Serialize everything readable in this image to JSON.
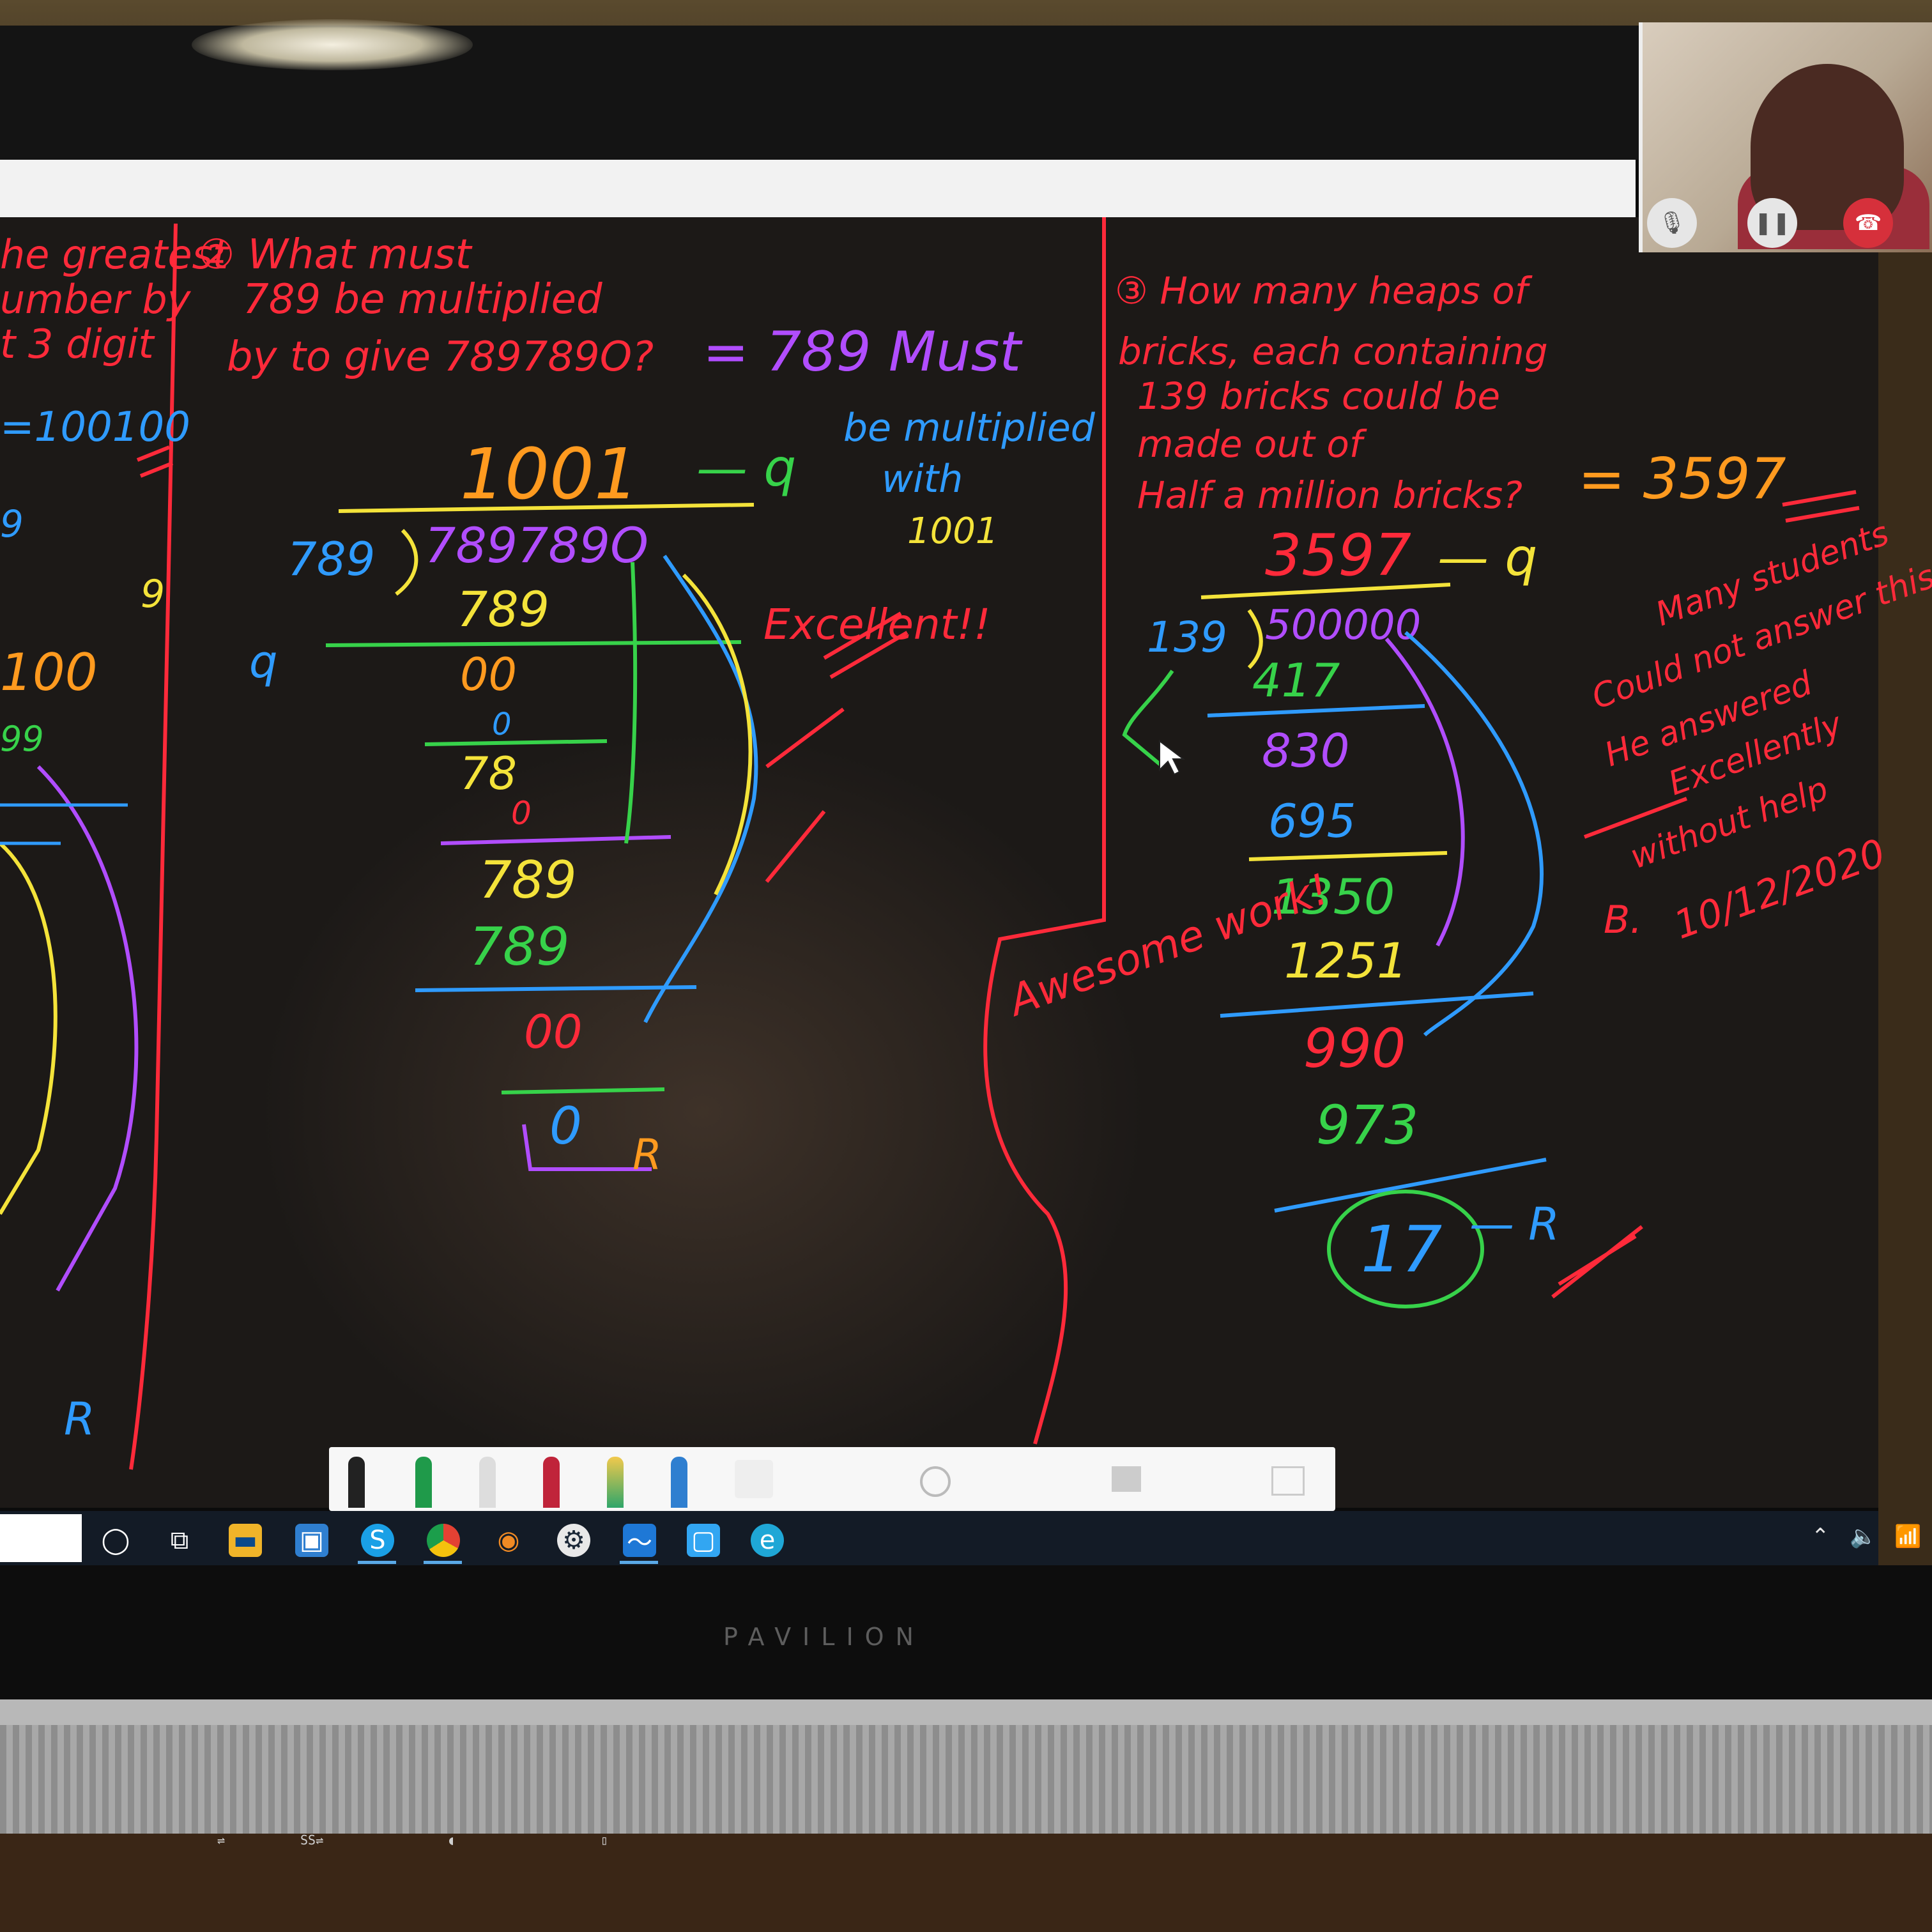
{
  "monitor": {
    "brand": "PAVILION"
  },
  "question_1": {
    "prompt_fragments": [
      "he greatest",
      "umber by",
      "t 3 digit"
    ],
    "answer_fragment": "=100100",
    "work_digits": [
      "9",
      "100",
      "99",
      "9"
    ],
    "remainder_mark": "R"
  },
  "question_2": {
    "prompt_lines": [
      "② What must",
      "789 be multiplied",
      "by to give 789789O?"
    ],
    "answer": "= 789 Must be multiplied with 1001",
    "answer_line1": "= 789 Must",
    "answer_line2": "be multiplied",
    "answer_line3": "with",
    "answer_line4": "1001",
    "quotient": "1001",
    "quotient_tag": "— q",
    "divisor": "789",
    "dividend": "789789O",
    "q_mark": "q",
    "steps": [
      "789",
      "00",
      "0",
      "78",
      "0",
      "789",
      "789",
      "00",
      "0"
    ],
    "remainder_mark": "R",
    "teacher_comment": "Excellent!!"
  },
  "question_3": {
    "prompt_lines": [
      "③ How many heaps of",
      "bricks, each containing",
      "139 bricks could be",
      "made out of",
      "Half a million bricks?"
    ],
    "answer": "= 3597",
    "quotient": "3597",
    "quotient_tag": "— q",
    "divisor": "139",
    "dividend": "500000",
    "steps": [
      "417",
      "830",
      "695",
      "1350",
      "1251",
      "990",
      "973",
      "17"
    ],
    "remainder_mark": "— R"
  },
  "teacher_notes": {
    "awesome": "Awesome work!",
    "note_lines": [
      "Many students",
      "Could not answer this",
      "He answered",
      "Excellently",
      "without help"
    ],
    "signature": "B.",
    "date": "10/12/2020"
  },
  "colors": {
    "board": "#1c1917",
    "red_ink": "#ff2a3a",
    "rainbow": [
      "#ff2a3a",
      "#ff9a1f",
      "#f4e33a",
      "#37d24a",
      "#2f9bff",
      "#b14dff"
    ]
  },
  "call_controls": [
    "mic-icon",
    "pause-icon",
    "end-call-icon"
  ],
  "taskbar_icons": [
    "cortana-icon",
    "task-view-icon",
    "file-explorer-icon",
    "store-icon",
    "skype-icon",
    "chrome-icon",
    "blender-icon",
    "steam-icon",
    "whiteboard-icon",
    "app-icon",
    "edge-icon"
  ],
  "tray_icons": [
    "chevron-up-icon",
    "volume-icon",
    "wifi-icon"
  ]
}
